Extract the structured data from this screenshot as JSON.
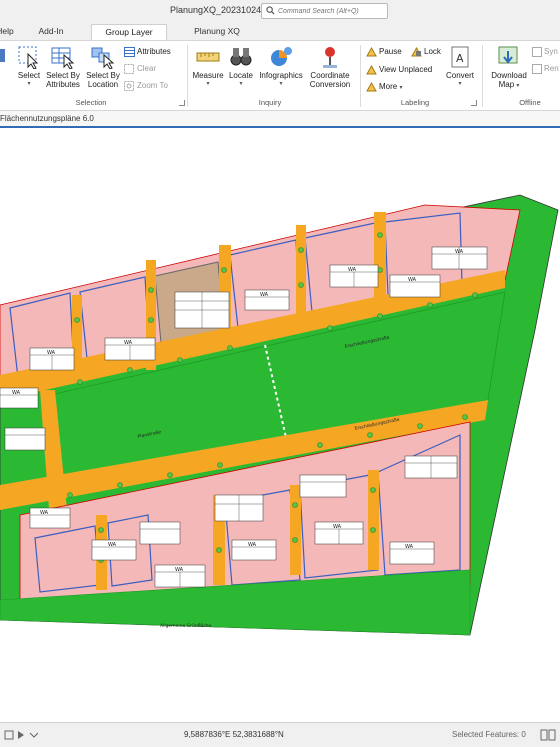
{
  "title_bar": {
    "document_title": "PlanungXQ_20231024",
    "search_placeholder": "Command Search (Alt+Q)"
  },
  "tabs": [
    {
      "label": "Help"
    },
    {
      "label": "Add-In"
    },
    {
      "label": "Group Layer",
      "selected": true
    },
    {
      "label": "Planung XQ"
    }
  ],
  "ribbon": {
    "selection": {
      "group_label": "Selection",
      "select": "Select",
      "select_by_attributes_1": "Select By",
      "select_by_attributes_2": "Attributes",
      "select_by_location_1": "Select By",
      "select_by_location_2": "Location",
      "attributes": "Attributes",
      "clear": "Clear",
      "zoom_to": "Zoom To"
    },
    "inquiry": {
      "group_label": "Inquiry",
      "measure": "Measure",
      "locate": "Locate",
      "infographics": "Infographics",
      "coordinate_conversion_1": "Coordinate",
      "coordinate_conversion_2": "Conversion"
    },
    "labeling": {
      "group_label": "Labeling",
      "pause": "Pause",
      "lock": "Lock",
      "view_unplaced": "View Unplaced",
      "more": "More",
      "convert": "Convert"
    },
    "offline": {
      "group_label": "Offline",
      "download_map_1": "Download",
      "download_map_2": "Map",
      "sync": "Syn",
      "remove": "Ren"
    }
  },
  "pane": {
    "title": "Flächennutzungspläne 6.0"
  },
  "map": {
    "colors": {
      "green": "#2bb934",
      "green_dark": "#1e9a27",
      "street": "#f5a623",
      "building_plot": "#f4b8b8",
      "building_border": "#3b5fc0",
      "selected_plot": "#c9a98a",
      "tree": "#57c24a",
      "outline": "#d00000"
    },
    "street_labels": [
      "Erschließungsstraße",
      "Erschließungsstraße",
      "Planstraße"
    ],
    "green_labels": [
      "Allgemeine Grünfläche"
    ],
    "zone_labels": [
      "WA",
      "WA",
      "WA",
      "WA",
      "WA",
      "WA",
      "WA",
      "WA",
      "WA",
      "WA",
      "WA",
      "WA",
      "WA"
    ]
  },
  "status_bar": {
    "coordinates": "9,5887836°E 52,3831688°N",
    "selected_features": "Selected Features: 0"
  }
}
